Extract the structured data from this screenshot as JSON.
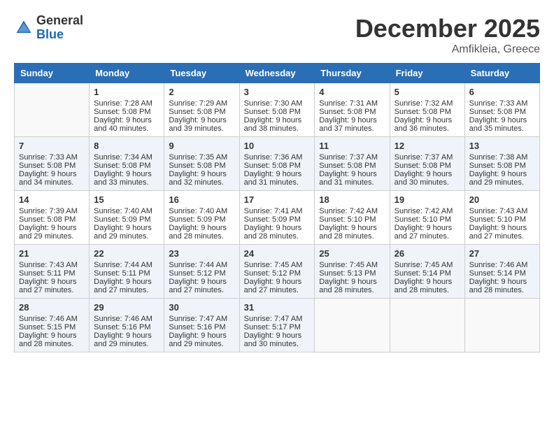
{
  "logo": {
    "general": "General",
    "blue": "Blue"
  },
  "title": {
    "month_year": "December 2025",
    "location": "Amfikleia, Greece"
  },
  "days_header": [
    "Sunday",
    "Monday",
    "Tuesday",
    "Wednesday",
    "Thursday",
    "Friday",
    "Saturday"
  ],
  "weeks": [
    {
      "row_class": "row-odd",
      "days": [
        {
          "num": "",
          "info": ""
        },
        {
          "num": "1",
          "info": "Sunrise: 7:28 AM\nSunset: 5:08 PM\nDaylight: 9 hours\nand 40 minutes."
        },
        {
          "num": "2",
          "info": "Sunrise: 7:29 AM\nSunset: 5:08 PM\nDaylight: 9 hours\nand 39 minutes."
        },
        {
          "num": "3",
          "info": "Sunrise: 7:30 AM\nSunset: 5:08 PM\nDaylight: 9 hours\nand 38 minutes."
        },
        {
          "num": "4",
          "info": "Sunrise: 7:31 AM\nSunset: 5:08 PM\nDaylight: 9 hours\nand 37 minutes."
        },
        {
          "num": "5",
          "info": "Sunrise: 7:32 AM\nSunset: 5:08 PM\nDaylight: 9 hours\nand 36 minutes."
        },
        {
          "num": "6",
          "info": "Sunrise: 7:33 AM\nSunset: 5:08 PM\nDaylight: 9 hours\nand 35 minutes."
        }
      ]
    },
    {
      "row_class": "row-even",
      "days": [
        {
          "num": "7",
          "info": "Sunrise: 7:33 AM\nSunset: 5:08 PM\nDaylight: 9 hours\nand 34 minutes."
        },
        {
          "num": "8",
          "info": "Sunrise: 7:34 AM\nSunset: 5:08 PM\nDaylight: 9 hours\nand 33 minutes."
        },
        {
          "num": "9",
          "info": "Sunrise: 7:35 AM\nSunset: 5:08 PM\nDaylight: 9 hours\nand 32 minutes."
        },
        {
          "num": "10",
          "info": "Sunrise: 7:36 AM\nSunset: 5:08 PM\nDaylight: 9 hours\nand 31 minutes."
        },
        {
          "num": "11",
          "info": "Sunrise: 7:37 AM\nSunset: 5:08 PM\nDaylight: 9 hours\nand 31 minutes."
        },
        {
          "num": "12",
          "info": "Sunrise: 7:37 AM\nSunset: 5:08 PM\nDaylight: 9 hours\nand 30 minutes."
        },
        {
          "num": "13",
          "info": "Sunrise: 7:38 AM\nSunset: 5:08 PM\nDaylight: 9 hours\nand 29 minutes."
        }
      ]
    },
    {
      "row_class": "row-odd",
      "days": [
        {
          "num": "14",
          "info": "Sunrise: 7:39 AM\nSunset: 5:08 PM\nDaylight: 9 hours\nand 29 minutes."
        },
        {
          "num": "15",
          "info": "Sunrise: 7:40 AM\nSunset: 5:09 PM\nDaylight: 9 hours\nand 29 minutes."
        },
        {
          "num": "16",
          "info": "Sunrise: 7:40 AM\nSunset: 5:09 PM\nDaylight: 9 hours\nand 28 minutes."
        },
        {
          "num": "17",
          "info": "Sunrise: 7:41 AM\nSunset: 5:09 PM\nDaylight: 9 hours\nand 28 minutes."
        },
        {
          "num": "18",
          "info": "Sunrise: 7:42 AM\nSunset: 5:10 PM\nDaylight: 9 hours\nand 28 minutes."
        },
        {
          "num": "19",
          "info": "Sunrise: 7:42 AM\nSunset: 5:10 PM\nDaylight: 9 hours\nand 27 minutes."
        },
        {
          "num": "20",
          "info": "Sunrise: 7:43 AM\nSunset: 5:10 PM\nDaylight: 9 hours\nand 27 minutes."
        }
      ]
    },
    {
      "row_class": "row-even",
      "days": [
        {
          "num": "21",
          "info": "Sunrise: 7:43 AM\nSunset: 5:11 PM\nDaylight: 9 hours\nand 27 minutes."
        },
        {
          "num": "22",
          "info": "Sunrise: 7:44 AM\nSunset: 5:11 PM\nDaylight: 9 hours\nand 27 minutes."
        },
        {
          "num": "23",
          "info": "Sunrise: 7:44 AM\nSunset: 5:12 PM\nDaylight: 9 hours\nand 27 minutes."
        },
        {
          "num": "24",
          "info": "Sunrise: 7:45 AM\nSunset: 5:12 PM\nDaylight: 9 hours\nand 27 minutes."
        },
        {
          "num": "25",
          "info": "Sunrise: 7:45 AM\nSunset: 5:13 PM\nDaylight: 9 hours\nand 28 minutes."
        },
        {
          "num": "26",
          "info": "Sunrise: 7:45 AM\nSunset: 5:14 PM\nDaylight: 9 hours\nand 28 minutes."
        },
        {
          "num": "27",
          "info": "Sunrise: 7:46 AM\nSunset: 5:14 PM\nDaylight: 9 hours\nand 28 minutes."
        }
      ]
    },
    {
      "row_class": "row-last",
      "days": [
        {
          "num": "28",
          "info": "Sunrise: 7:46 AM\nSunset: 5:15 PM\nDaylight: 9 hours\nand 28 minutes."
        },
        {
          "num": "29",
          "info": "Sunrise: 7:46 AM\nSunset: 5:16 PM\nDaylight: 9 hours\nand 29 minutes."
        },
        {
          "num": "30",
          "info": "Sunrise: 7:47 AM\nSunset: 5:16 PM\nDaylight: 9 hours\nand 29 minutes."
        },
        {
          "num": "31",
          "info": "Sunrise: 7:47 AM\nSunset: 5:17 PM\nDaylight: 9 hours\nand 30 minutes."
        },
        {
          "num": "",
          "info": ""
        },
        {
          "num": "",
          "info": ""
        },
        {
          "num": "",
          "info": ""
        }
      ]
    }
  ]
}
